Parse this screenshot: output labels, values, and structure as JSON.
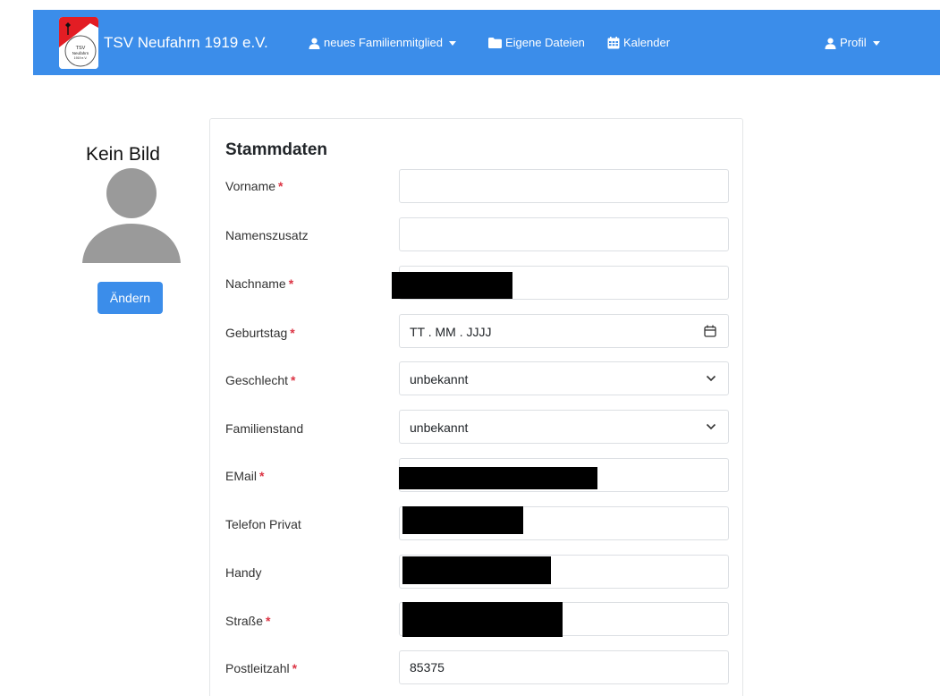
{
  "navbar": {
    "brand": "TSV Neufahrn 1919 e.V.",
    "logo_text": "TSV Neufahrn 1919 e.V.",
    "items": [
      {
        "label": "neues Familienmitglied",
        "icon": "user-icon",
        "dropdown": true
      },
      {
        "label": "Eigene Dateien",
        "icon": "folder-icon"
      },
      {
        "label": "Kalender",
        "icon": "calendar-grid-icon"
      }
    ],
    "profile": {
      "label": "Profil",
      "icon": "user-icon",
      "dropdown": true
    },
    "color": "#3b8dea"
  },
  "photo": {
    "caption": "Kein Bild",
    "change_label": "Ändern"
  },
  "form": {
    "title": "Stammdaten",
    "required_marker": "*",
    "fields": {
      "vorname": {
        "label": "Vorname",
        "required": true,
        "value": ""
      },
      "namenszusatz": {
        "label": "Namenszusatz",
        "required": false,
        "value": ""
      },
      "nachname": {
        "label": "Nachname",
        "required": true,
        "redacted": true
      },
      "geburtstag": {
        "label": "Geburtstag",
        "required": true,
        "placeholder": "TT . MM . JJJJ"
      },
      "geschlecht": {
        "label": "Geschlecht",
        "required": true,
        "selected": "unbekannt"
      },
      "familienstand": {
        "label": "Familienstand",
        "required": false,
        "selected": "unbekannt"
      },
      "email": {
        "label": "EMail",
        "required": true,
        "redacted": true
      },
      "telefon_privat": {
        "label": "Telefon Privat",
        "required": false,
        "redacted": true
      },
      "handy": {
        "label": "Handy",
        "required": false,
        "redacted": true
      },
      "strasse": {
        "label": "Straße",
        "required": true,
        "redacted": true
      },
      "postleitzahl": {
        "label": "Postleitzahl",
        "required": true,
        "value": "85375"
      }
    }
  }
}
